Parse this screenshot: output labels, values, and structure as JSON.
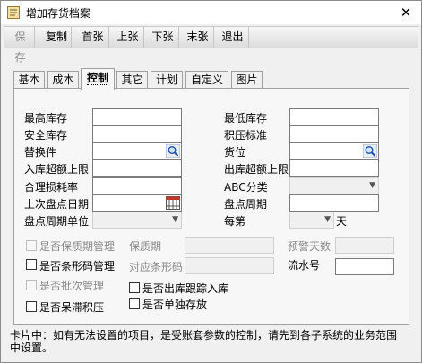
{
  "window": {
    "title": "增加存货档案",
    "close_glyph": "✕"
  },
  "toolbar": [
    {
      "label": "保存",
      "disabled": true
    },
    {
      "label": "复制",
      "disabled": false
    },
    {
      "label": "首张",
      "disabled": false
    },
    {
      "label": "上张",
      "disabled": false
    },
    {
      "label": "下张",
      "disabled": false
    },
    {
      "label": "末张",
      "disabled": false
    },
    {
      "label": "退出",
      "disabled": false
    }
  ],
  "tabs": [
    {
      "label": "基本",
      "active": false
    },
    {
      "label": "成本",
      "active": false
    },
    {
      "label": "控制",
      "active": true
    },
    {
      "label": "其它",
      "active": false
    },
    {
      "label": "计划",
      "active": false
    },
    {
      "label": "自定义",
      "active": false
    },
    {
      "label": "图片",
      "active": false
    }
  ],
  "form": {
    "max_stock": {
      "label": "最高库存",
      "value": ""
    },
    "min_stock": {
      "label": "最低库存",
      "value": ""
    },
    "safety_stock": {
      "label": "安全库存",
      "value": ""
    },
    "overstock_std": {
      "label": "积压标准",
      "value": ""
    },
    "substitute": {
      "label": "替换件",
      "value": ""
    },
    "location": {
      "label": "货位",
      "value": ""
    },
    "in_over_limit": {
      "label": "入库超额上限",
      "value": ""
    },
    "out_over_limit": {
      "label": "出库超额上限",
      "value": ""
    },
    "loss_rate": {
      "label": "合理损耗率",
      "value": ""
    },
    "abc_class": {
      "label": "ABC分类",
      "value": ""
    },
    "last_count_date": {
      "label": "上次盘点日期",
      "value": ""
    },
    "count_cycle": {
      "label": "盘点周期",
      "value": ""
    },
    "count_cycle_unit": {
      "label": "盘点周期单位",
      "value": ""
    },
    "every": {
      "label": "每第",
      "value": "",
      "suffix": "天"
    }
  },
  "options": {
    "shelf_life_mgmt": {
      "label": "是否保质期管理",
      "checked": false,
      "disabled": true
    },
    "shelf_life": {
      "label": "保质期",
      "value": ""
    },
    "warning_days": {
      "label": "预警天数",
      "value": ""
    },
    "barcode_mgmt": {
      "label": "是否条形码管理",
      "checked": false,
      "disabled": false
    },
    "barcode": {
      "label": "对应条形码",
      "value": ""
    },
    "serial_no": {
      "label": "流水号",
      "value": ""
    },
    "batch_mgmt": {
      "label": "是否批次管理",
      "checked": false,
      "disabled": true
    },
    "out_track_in": {
      "label": "是否出库跟踪入库",
      "checked": false,
      "disabled": false
    },
    "stagnant": {
      "label": "是否呆滞积压",
      "checked": false,
      "disabled": false
    },
    "single_stock": {
      "label": "是否单独存放",
      "checked": false,
      "disabled": false
    }
  },
  "hint": "卡片中：如有无法设置的项目，是受账套参数的控制，请先到各子系统的业务范围中设置。",
  "icons": {
    "lookup": "magnifier-icon",
    "calendar": "calendar-icon",
    "dropdown": "chevron-down-icon"
  }
}
